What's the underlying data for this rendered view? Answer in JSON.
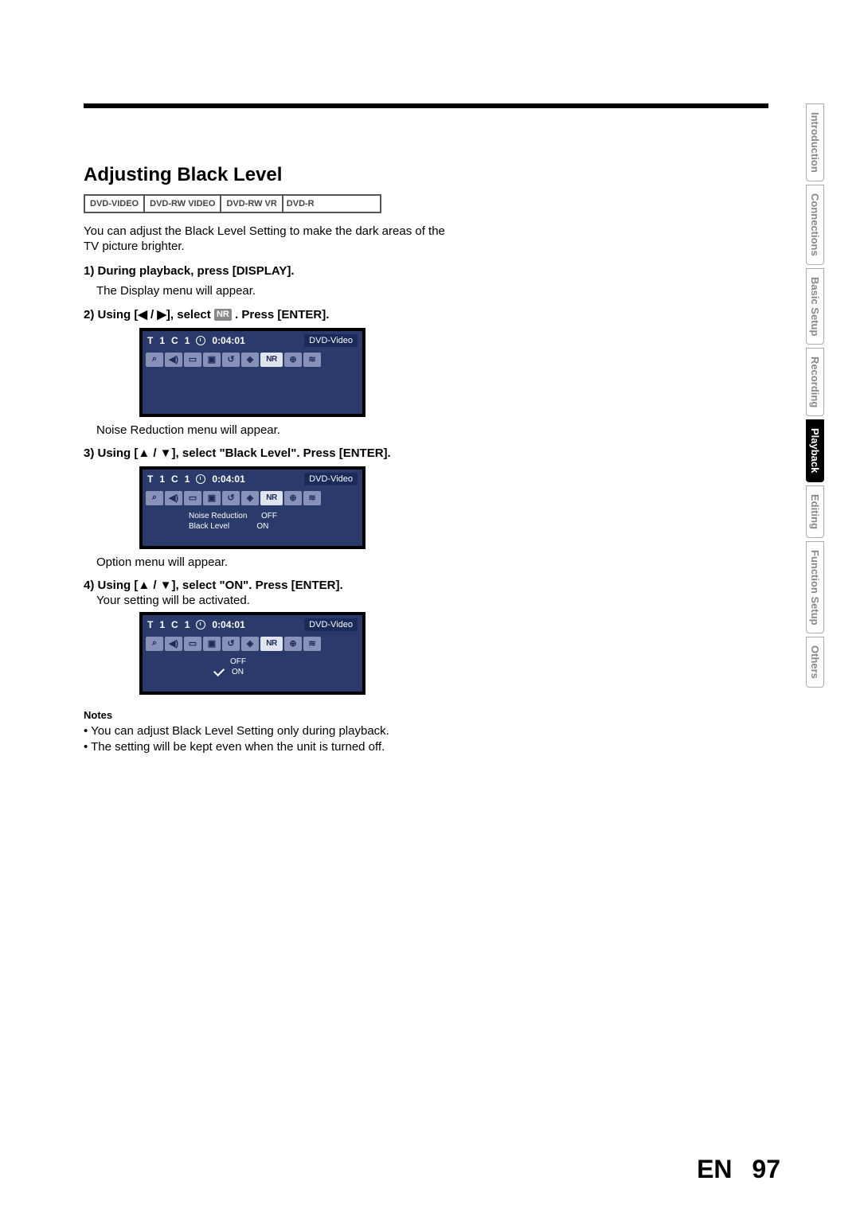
{
  "heading": "Adjusting Black Level",
  "disc_tabs": [
    "DVD-VIDEO",
    "DVD-RW VIDEO",
    "DVD-RW VR",
    "DVD-R"
  ],
  "intro": "You can adjust the Black Level Setting to make the dark areas of the TV picture brighter.",
  "step1_title": "1) During playback, press [DISPLAY].",
  "step1_caption": "The Display menu will appear.",
  "step2_title_a": "2) Using [◀ / ▶], select ",
  "nr_chip": "NR",
  "step2_title_b": " . Press [ENTER].",
  "step2_caption": "Noise Reduction menu will appear.",
  "step3_title": "3) Using [▲ / ▼], select \"Black Level\". Press [ENTER].",
  "step3_caption": "Option menu will appear.",
  "step4_title": "4) Using [▲ / ▼], select \"ON\". Press [ENTER].",
  "step4_caption": "Your setting will be activated.",
  "notes_h": "Notes",
  "notes": [
    "• You can adjust Black Level Setting only during playback.",
    "• The setting will be kept even when the unit is turned off."
  ],
  "osd": {
    "t_label": "T",
    "t_val": "1",
    "c_label": "C",
    "c_val": "1",
    "time": "0:04:01",
    "format": "DVD-Video",
    "icon_nr": "NR",
    "menu_nr_label": "Noise Reduction",
    "menu_nr_val": "OFF",
    "menu_bl_label": "Black Level",
    "menu_bl_val": "ON",
    "opt_off": "OFF",
    "opt_on": "ON"
  },
  "footer": {
    "lang": "EN",
    "page": "97"
  },
  "side_tabs": [
    {
      "label": "Introduction",
      "active": false
    },
    {
      "label": "Connections",
      "active": false
    },
    {
      "label": "Basic Setup",
      "active": false
    },
    {
      "label": "Recording",
      "active": false
    },
    {
      "label": "Playback",
      "active": true
    },
    {
      "label": "Editing",
      "active": false
    },
    {
      "label": "Function Setup",
      "active": false
    },
    {
      "label": "Others",
      "active": false
    }
  ]
}
